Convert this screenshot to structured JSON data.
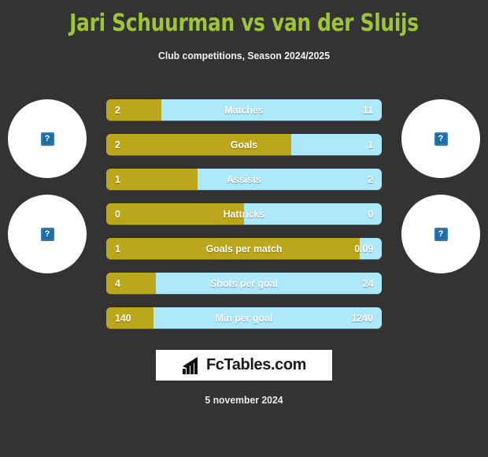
{
  "header": {
    "title": "Jari Schuurman vs van der Sluijs",
    "subtitle": "Club competitions, Season 2024/2025",
    "title_color": "#9ec438"
  },
  "avatars": {
    "placeholder_glyph": "?",
    "items": [
      {
        "name": "player-left-top",
        "side": "left",
        "row": 1
      },
      {
        "name": "player-left-bottom",
        "side": "left",
        "row": 2
      },
      {
        "name": "player-right-top",
        "side": "right",
        "row": 1
      },
      {
        "name": "player-right-bottom",
        "side": "right",
        "row": 2
      }
    ]
  },
  "logo": {
    "text": "FcTables.com"
  },
  "footer": {
    "date": "5 november 2024"
  },
  "colors": {
    "background": "#333333",
    "left_player": "#bca61c",
    "right_player": "#aee9fb",
    "title": "#9ec438",
    "text": "#ffffff"
  },
  "chart_data": {
    "type": "bar",
    "title": "Jari Schuurman vs van der Sluijs",
    "subtitle": "Club competitions, Season 2024/2025",
    "orientation": "horizontal-diverging",
    "series": [
      {
        "name": "Jari Schuurman",
        "color": "#bca61c",
        "side": "left"
      },
      {
        "name": "van der Sluijs",
        "color": "#aee9fb",
        "side": "right"
      }
    ],
    "categories": [
      "Matches",
      "Goals",
      "Assists",
      "Hattricks",
      "Goals per match",
      "Shots per goal",
      "Min per goal"
    ],
    "rows": [
      {
        "label": "Matches",
        "left_value": "2",
        "right_value": "11",
        "left_pct": 20
      },
      {
        "label": "Goals",
        "left_value": "2",
        "right_value": "1",
        "left_pct": 67
      },
      {
        "label": "Assists",
        "left_value": "1",
        "right_value": "2",
        "left_pct": 33
      },
      {
        "label": "Hattricks",
        "left_value": "0",
        "right_value": "0",
        "left_pct": 50
      },
      {
        "label": "Goals per match",
        "left_value": "1",
        "right_value": "0.09",
        "left_pct": 92
      },
      {
        "label": "Shots per goal",
        "left_value": "4",
        "right_value": "24",
        "left_pct": 18
      },
      {
        "label": "Min per goal",
        "left_value": "140",
        "right_value": "1240",
        "left_pct": 17
      }
    ],
    "xlabel": "",
    "ylabel": "",
    "grid": false,
    "legend": "none"
  }
}
